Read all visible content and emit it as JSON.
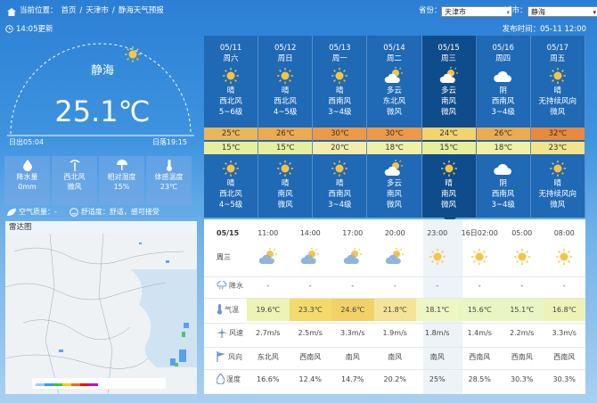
{
  "nav": {
    "location_label": "当前位置：",
    "crumbs": [
      "首页",
      "天津市",
      "静海天气预报"
    ],
    "province_label": "省份：",
    "province_value": "天津市",
    "city_label": "城市：",
    "city_value": "静海"
  },
  "current": {
    "updated": "14:05更新",
    "published": "发布时间：05-11 12:00",
    "city": "静海",
    "temperature": "25.1℃",
    "sunrise": "日出05:04",
    "sunset": "日落19:15"
  },
  "stats": [
    {
      "label": "降水量",
      "value": "0mm",
      "icon": "raindrop-icon"
    },
    {
      "label": "西北风",
      "value": "微风",
      "icon": "wind-icon"
    },
    {
      "label": "相对湿度",
      "value": "15%",
      "icon": "humidity-icon"
    },
    {
      "label": "体感温度",
      "value": "23℃",
      "icon": "thermometer-icon"
    }
  ],
  "aqi": {
    "air_label": "空气质量：-",
    "comfort_label": "舒适度：舒适，感可接受"
  },
  "radar": {
    "title": "雷达图"
  },
  "daily": [
    {
      "date": "05/11",
      "weekday": "周六",
      "day_icon": "sunny-icon",
      "day_weather": "晴",
      "day_wind": "西北风",
      "day_wind_level": "5~6级",
      "high": "25℃",
      "low": "15℃",
      "night_icon": "sunny-icon",
      "night_weather": "晴",
      "night_wind": "西北风",
      "night_wind_level": "4~5级",
      "high_color": "#e9b659",
      "low_color": "#e7ee9c"
    },
    {
      "date": "05/12",
      "weekday": "周日",
      "day_icon": "sunny-icon",
      "day_weather": "晴",
      "day_wind": "西北风",
      "day_wind_level": "4~5级",
      "high": "26℃",
      "low": "15℃",
      "night_icon": "sunny-icon",
      "night_weather": "晴",
      "night_wind": "南风",
      "night_wind_level": "微风",
      "high_color": "#ecab51",
      "low_color": "#e7ee9c"
    },
    {
      "date": "05/13",
      "weekday": "周一",
      "day_icon": "sunny-icon",
      "day_weather": "晴",
      "day_wind": "西南风",
      "day_wind_level": "3~4级",
      "high": "30℃",
      "low": "20℃",
      "night_icon": "sunny-icon",
      "night_weather": "晴",
      "night_wind": "西南风",
      "night_wind_level": "3~4级",
      "high_color": "#ec9a45",
      "low_color": "#f4ecab"
    },
    {
      "date": "05/14",
      "weekday": "周二",
      "day_icon": "partly-cloudy-icon",
      "day_weather": "多云",
      "day_wind": "东北风",
      "day_wind_level": "微风",
      "high": "30℃",
      "low": "18℃",
      "night_icon": "partly-cloudy-icon",
      "night_weather": "多云",
      "night_wind": "南风",
      "night_wind_level": "微风",
      "high_color": "#ec9a45",
      "low_color": "#f1f0a4"
    },
    {
      "date": "05/15",
      "weekday": "周三",
      "day_icon": "partly-cloudy-icon",
      "day_weather": "多云",
      "day_wind": "南风",
      "day_wind_level": "微风",
      "high": "24℃",
      "low": "15℃",
      "night_icon": "sunny-icon",
      "night_weather": "晴",
      "night_wind": "南风",
      "night_wind_level": "微风",
      "high_color": "#f4d26c",
      "low_color": "#e7ee9c"
    },
    {
      "date": "05/16",
      "weekday": "周四",
      "day_icon": "cloudy-icon",
      "day_weather": "阴",
      "day_wind": "西南风",
      "day_wind_level": "3~4级",
      "high": "26℃",
      "low": "18℃",
      "night_icon": "cloudy-icon",
      "night_weather": "阴",
      "night_wind": "西南风",
      "night_wind_level": "3~4级",
      "high_color": "#ecab51",
      "low_color": "#f1f0a4"
    },
    {
      "date": "05/17",
      "weekday": "周五",
      "day_icon": "sunny-icon",
      "day_weather": "晴",
      "day_wind": "无持续风向",
      "day_wind_level": "微风",
      "high": "32℃",
      "low": "23℃",
      "night_icon": "sunny-icon",
      "night_weather": "晴",
      "night_wind": "无持续风向",
      "night_wind_level": "微风",
      "high_color": "#e88a3e",
      "low_color": "#f3e48a"
    }
  ],
  "hourly": {
    "date": "05/15",
    "weekday": "周三",
    "times": [
      "11:00",
      "14:00",
      "17:00",
      "20:00",
      "23:00",
      "16日02:00",
      "05:00",
      "08:00"
    ],
    "icons": [
      "partly-cloudy-icon",
      "partly-cloudy-icon",
      "partly-cloudy-icon",
      "partly-cloudy-icon",
      "sunny-icon",
      "sunny-icon",
      "sunny-icon",
      "sunny-icon"
    ],
    "rows": [
      {
        "label": "降水",
        "icon": "rain-icon",
        "values": [
          "-",
          "-",
          "-",
          "-",
          "-",
          "-",
          "-",
          "-"
        ]
      },
      {
        "label": "气温",
        "icon": "thermometer-icon",
        "values": [
          "19.6℃",
          "23.3℃",
          "24.6℃",
          "21.8℃",
          "18.1℃",
          "15.6℃",
          "15.1℃",
          "16.8℃"
        ],
        "colors": [
          "#ecf3b5",
          "#f4da6a",
          "#f2d166",
          "#f5e497",
          "#eef6c4",
          "#e9f5c2",
          "#e9f5c2",
          "#ecf3b5"
        ]
      },
      {
        "label": "风速",
        "icon": "plane-icon",
        "values": [
          "2.7m/s",
          "2.5m/s",
          "3.3m/s",
          "1.9m/s",
          "1.8m/s",
          "1.4m/s",
          "2.2m/s",
          "3.3m/s"
        ]
      },
      {
        "label": "风向",
        "icon": "flag-icon",
        "values": [
          "东北风",
          "西南风",
          "南风",
          "南风",
          "南风",
          "西南风",
          "西南风",
          "西南风"
        ]
      },
      {
        "label": "湿度",
        "icon": "droplet-icon",
        "values": [
          "16.6%",
          "12.4%",
          "14.7%",
          "20.2%",
          "25%",
          "28.5%",
          "30.3%",
          "30.3%"
        ]
      }
    ]
  }
}
